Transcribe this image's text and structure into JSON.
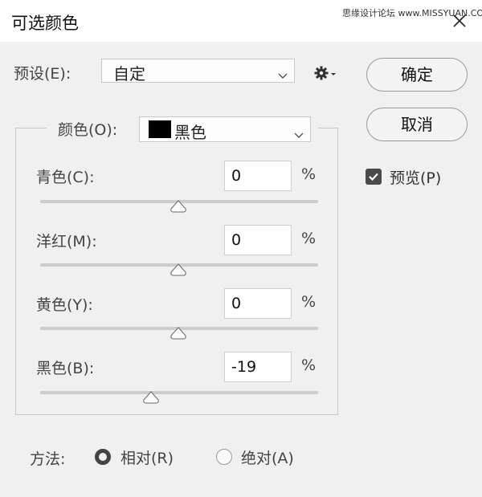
{
  "window": {
    "title": "可选颜色",
    "watermark": "思缘设计论坛 www.MISSYUAN.COM"
  },
  "preset": {
    "label": "预设(E):",
    "value": "自定"
  },
  "buttons": {
    "ok": "确定",
    "cancel": "取消"
  },
  "preview": {
    "label": "预览(P)",
    "checked": true
  },
  "color": {
    "label": "颜色(O):",
    "value": "黑色",
    "swatch_color": "#000000"
  },
  "sliders": [
    {
      "label": "青色(C):",
      "value": "0",
      "unit": "%",
      "percent": 0
    },
    {
      "label": "洋红(M):",
      "value": "0",
      "unit": "%",
      "percent": 0
    },
    {
      "label": "黄色(Y):",
      "value": "0",
      "unit": "%",
      "percent": 0
    },
    {
      "label": "黑色(B):",
      "value": "-19",
      "unit": "%",
      "percent": -19
    }
  ],
  "method": {
    "label": "方法:",
    "options": [
      {
        "label": "相对(R)",
        "selected": true
      },
      {
        "label": "绝对(A)",
        "selected": false
      }
    ]
  }
}
